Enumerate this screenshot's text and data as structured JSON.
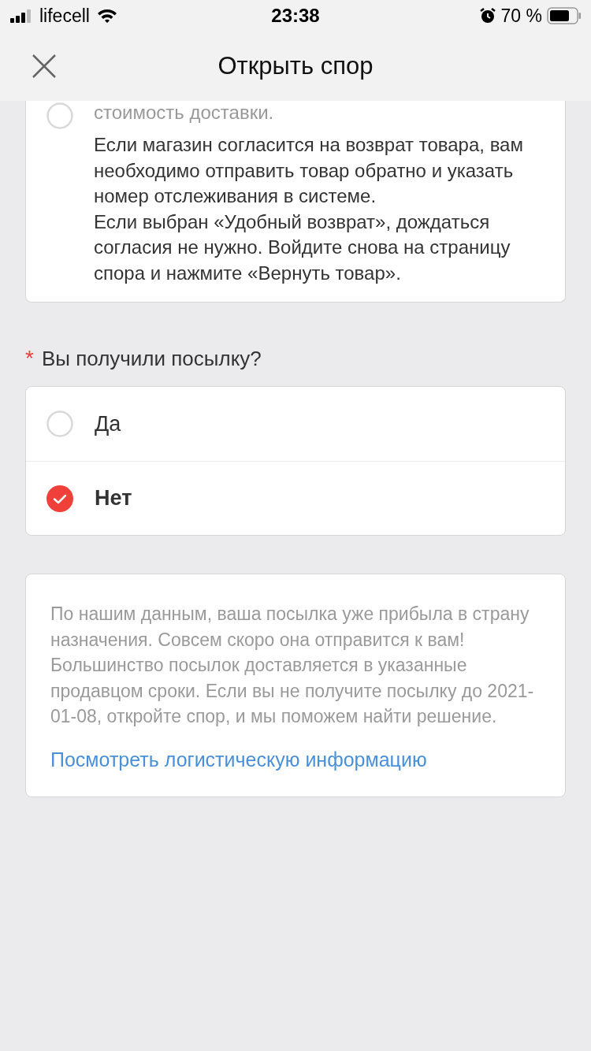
{
  "status_bar": {
    "carrier": "lifecell",
    "time": "23:38",
    "battery": "70 %"
  },
  "header": {
    "title": "Открыть спор"
  },
  "return_option": {
    "selected": false,
    "title": "стоимость доставки.",
    "paragraphs": [
      "Если магазин согласится на возврат товара, вам необходимо отправить товар обратно и указать номер отслеживания в системе.",
      "Если выбран «Удобный возврат», дождаться согласия не нужно. Войдите снова на страницу спора и нажмите «Вернуть товар»."
    ]
  },
  "question": {
    "required_mark": "*",
    "label": "Вы получили посылку?",
    "options": [
      {
        "label": "Да",
        "selected": false
      },
      {
        "label": "Нет",
        "selected": true
      }
    ]
  },
  "info": {
    "text": "По нашим данным, ваша посылка уже прибыла в страну назначения. Совсем скоро она отправится к вам! Большинство посылок доставляется в указанные продавцом сроки. Если вы не получите посылку до 2021-01-08, откройте спор, и мы поможем найти решение.",
    "link": "Посмотреть логистическую информацию"
  }
}
